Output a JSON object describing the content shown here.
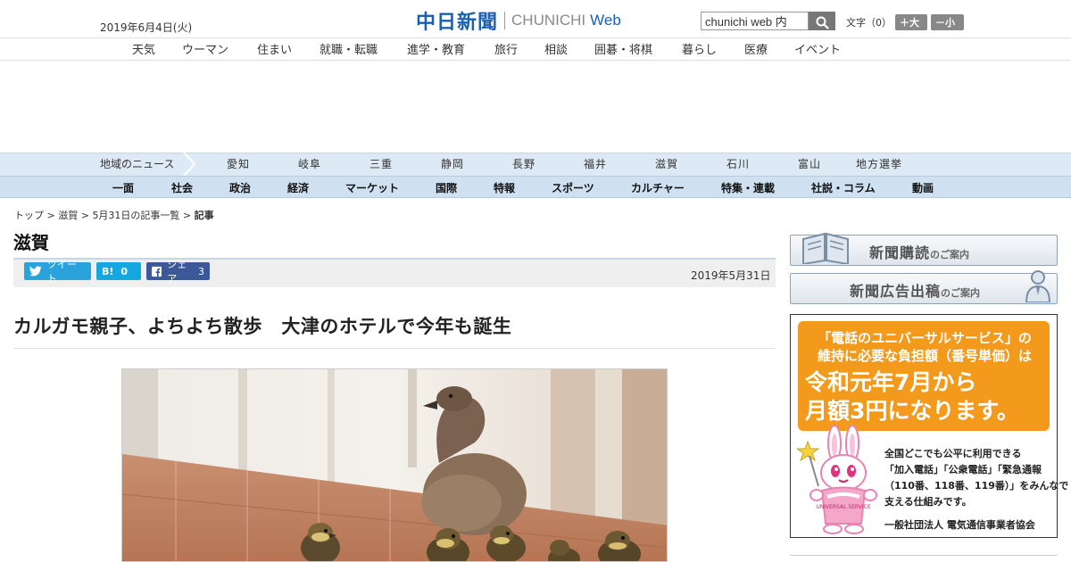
{
  "header": {
    "date": "2019年6月4日(火)",
    "logo_jp": "中日新聞",
    "logo_en": "CHUNICHI",
    "logo_web": "Web",
    "search_value": "chunichi web 内",
    "font_label": "文字（0）",
    "font_plus": "＋大",
    "font_minus": "－小"
  },
  "subnav": [
    "天気",
    "ウーマン",
    "住まい",
    "就職・転職",
    "進学・教育",
    "旅行",
    "相談",
    "囲碁・将棋",
    "暮らし",
    "医療",
    "イベント"
  ],
  "region": {
    "label": "地域のニュース",
    "items": [
      "愛知",
      "岐阜",
      "三重",
      "静岡",
      "長野",
      "福井",
      "滋賀",
      "石川",
      "富山",
      "地方選挙"
    ]
  },
  "categories": [
    "一面",
    "社会",
    "政治",
    "経済",
    "マーケット",
    "国際",
    "特報",
    "スポーツ",
    "カルチャー",
    "特集・連載",
    "社説・コラム",
    "動画"
  ],
  "breadcrumb": {
    "top": "トップ",
    "shiga": "滋賀",
    "list": "5月31日の記事一覧",
    "current": "記事",
    "sep": " > "
  },
  "section_title": "滋賀",
  "share": {
    "tweet": "ツイート",
    "hatena_count": "0",
    "hatena_mark": "B!",
    "fb_label": "シェア",
    "fb_count": "3"
  },
  "article": {
    "date": "2019年5月31日",
    "headline": "カルガモ親子、よちよち散歩　大津のホテルで今年も誕生"
  },
  "sidebar": {
    "subscribe_big": "新聞購読",
    "subscribe_small": "のご案内",
    "ad_big": "新聞広告出稿",
    "ad_small": "のご案内"
  },
  "ad": {
    "line1": "「電話のユニバーサルサービス」の",
    "line2": "維持に必要な負担額（番号単価）は",
    "line3": "令和元年7月から",
    "line4": "月額3円になります。",
    "sub1": "全国どこでも公平に利用できる",
    "sub2": "「加入電話」「公衆電話」「緊急通報",
    "sub3": "（110番、118番、119番）」をみんなで",
    "sub4": "支える仕組みです。",
    "org": "一般社団法人 電気通信事業者協会",
    "mascot_text": "UNIVERSAL SERVICE"
  },
  "colors": {
    "brand_blue": "#1a5fb4",
    "region_bg": "#dde9f5",
    "category_bg": "#cfe0f0",
    "twitter": "#2aa3dc",
    "hatena": "#15a7e0",
    "facebook": "#3b5998",
    "ad_orange": "#f39a1c"
  }
}
